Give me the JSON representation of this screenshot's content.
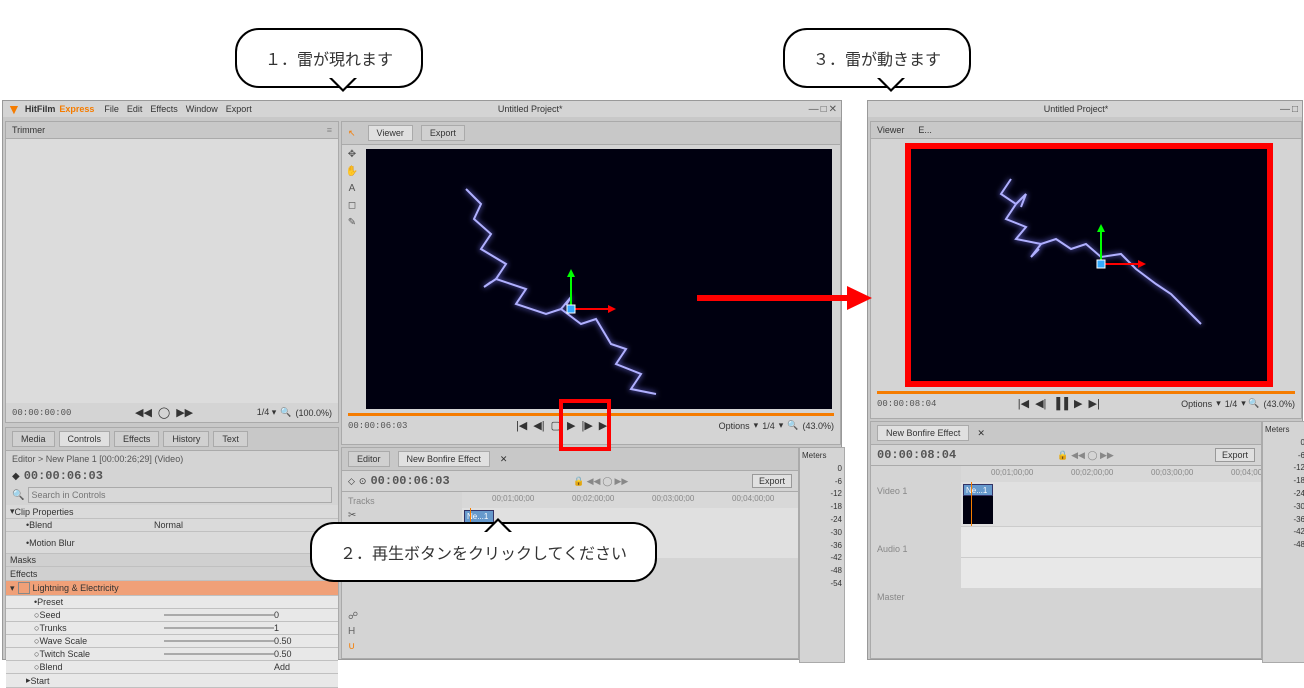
{
  "app": {
    "name_a": "HitFilm",
    "name_b": "Express",
    "project": "Untitled Project*"
  },
  "menu": {
    "file": "File",
    "edit": "Edit",
    "effects": "Effects",
    "window": "Window",
    "export": "Export"
  },
  "trimmer": {
    "title": "Trimmer"
  },
  "media_tabs": {
    "media": "Media",
    "controls": "Controls",
    "effects": "Effects",
    "history": "History",
    "text": "Text"
  },
  "editor_line": "Editor > New Plane 1 [00:00:26;29] (Video)",
  "time1": "00:00:06:03",
  "time2": "00:00:08:04",
  "tc_start": "00:00:06:03",
  "tc_end": "00:00:06:03",
  "tc_start2": "00:00:08:04",
  "tc_end2": "00:00:08:04",
  "search_ph": "Search in Controls",
  "props": {
    "clip": "Clip Properties",
    "blend": "Blend",
    "blend_v": "Normal",
    "motion": "Motion Blur",
    "masks": "Masks",
    "effects": "Effects",
    "lightning": "Lightning & Electricity",
    "preset": "Preset",
    "seed": "Seed",
    "seed_v": "0",
    "trunks": "Trunks",
    "trunks_v": "1",
    "wave": "Wave Scale",
    "wave_v": "0.50",
    "twitch": "Twitch Scale",
    "twitch_v": "0.50",
    "blend2": "Blend",
    "blend2_v": "Add",
    "start": "Start"
  },
  "viewer": {
    "tab1": "Viewer",
    "tab2": "Export",
    "options": "Options",
    "zoom": "1/4",
    "pct": "(43.0%)"
  },
  "zoom_btm": "(100.0%)",
  "editor": {
    "tab": "Editor",
    "bonfire": "New Bonfire Effect",
    "tracks": "Tracks",
    "video1": "Video 1",
    "audio1": "Audio 1",
    "master": "Master",
    "export": "Export",
    "ruler": [
      "00;01;00;00",
      "00;02;00;00",
      "00;03;00;00",
      "00;04;00;00"
    ],
    "clip": "Ne...1"
  },
  "meters": {
    "title": "Meters",
    "vals": [
      "0",
      "-6",
      "-12",
      "-18",
      "-24",
      "-30",
      "-36",
      "-42",
      "-48",
      "-54"
    ]
  },
  "callouts": {
    "c1": "１．雷が現れます",
    "c2": "２．再生ボタンをクリックしてください",
    "c3": "３．雷が動きます"
  }
}
